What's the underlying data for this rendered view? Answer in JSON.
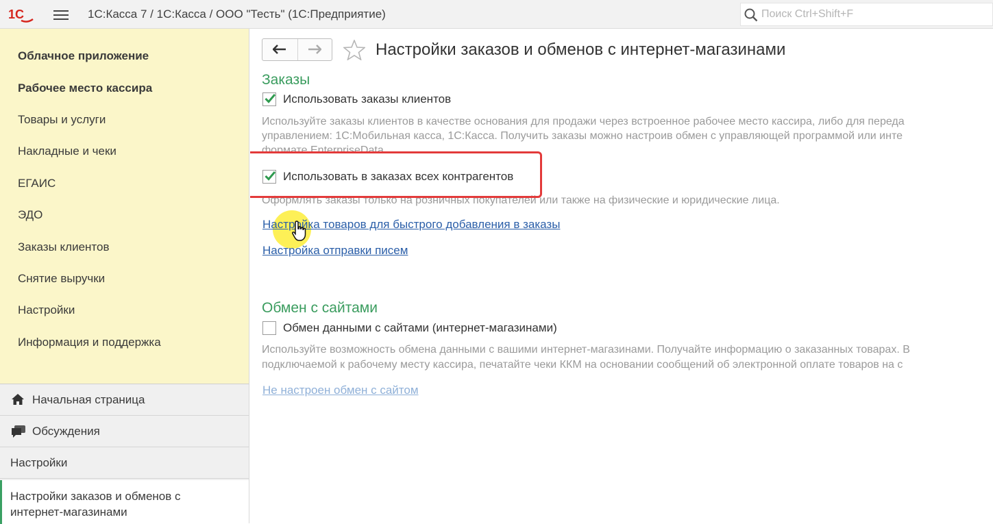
{
  "titlebar": {
    "logo_text": "1С",
    "title": "1С:Касса 7 / 1С:Касса / ООО \"Тесть\"  (1С:Предприятие)",
    "search_placeholder": "Поиск Ctrl+Shift+F"
  },
  "sidebar": {
    "items": [
      {
        "label": "Облачное приложение",
        "bold": true
      },
      {
        "label": "Рабочее место кассира",
        "bold": true
      },
      {
        "label": "Товары и услуги"
      },
      {
        "label": "Накладные и чеки"
      },
      {
        "label": "ЕГАИС"
      },
      {
        "label": "ЭДО"
      },
      {
        "label": "Заказы клиентов"
      },
      {
        "label": "Снятие выручки"
      },
      {
        "label": "Настройки"
      },
      {
        "label": "Информация и поддержка"
      }
    ]
  },
  "bottom_nav": {
    "home": "Начальная страница",
    "discussions": "Обсуждения",
    "settings": "Настройки",
    "active": "Настройки заказов и обменов с интернет-магазинами"
  },
  "main": {
    "title": "Настройки заказов и обменов с интернет-магазинами",
    "orders": {
      "section_title": "Заказы",
      "use_orders": {
        "label": "Использовать заказы клиентов",
        "checked": true
      },
      "use_orders_desc_1": "Используйте заказы клиентов в качестве основания для продажи через встроенное рабочее место кассира, либо для переда",
      "use_orders_desc_2": "управлением: 1С:Мобильная касса, 1С:Касса. Получить заказы можно настроив обмен с управляющей программой или инте",
      "use_orders_desc_3": "формате EnterpriseData.",
      "all_counterparties": {
        "label": "Использовать в заказах всех контрагентов",
        "checked": true
      },
      "all_counterparties_desc": "Оформлять заказы только на розничных покупателей или также на физические и юридические лица.",
      "link_goods": "Настройка товаров для быстрого добавления в заказы",
      "link_mail": "Настройка отправки писем"
    },
    "exchange": {
      "section_title": "Обмен с сайтами",
      "exchange_sites": {
        "label": "Обмен данными с сайтами (интернет-магазинами)",
        "checked": false
      },
      "desc_1": "Используйте возможность обмена данными с вашими интернет-магазинами. Получайте информацию о заказанных товарах. В",
      "desc_2": "подключаемой к рабочему месту кассира, печатайте чеки ККМ на основании сообщений об электронной оплате товаров на с",
      "link_status": "Не настроен обмен с сайтом"
    }
  },
  "colors": {
    "sidebar_bg": "#fbf6c9",
    "section_green": "#3a9c5e",
    "link_blue": "#2a5ea8",
    "highlight_red": "#e33a3a",
    "check_green": "#2f9a4f"
  }
}
